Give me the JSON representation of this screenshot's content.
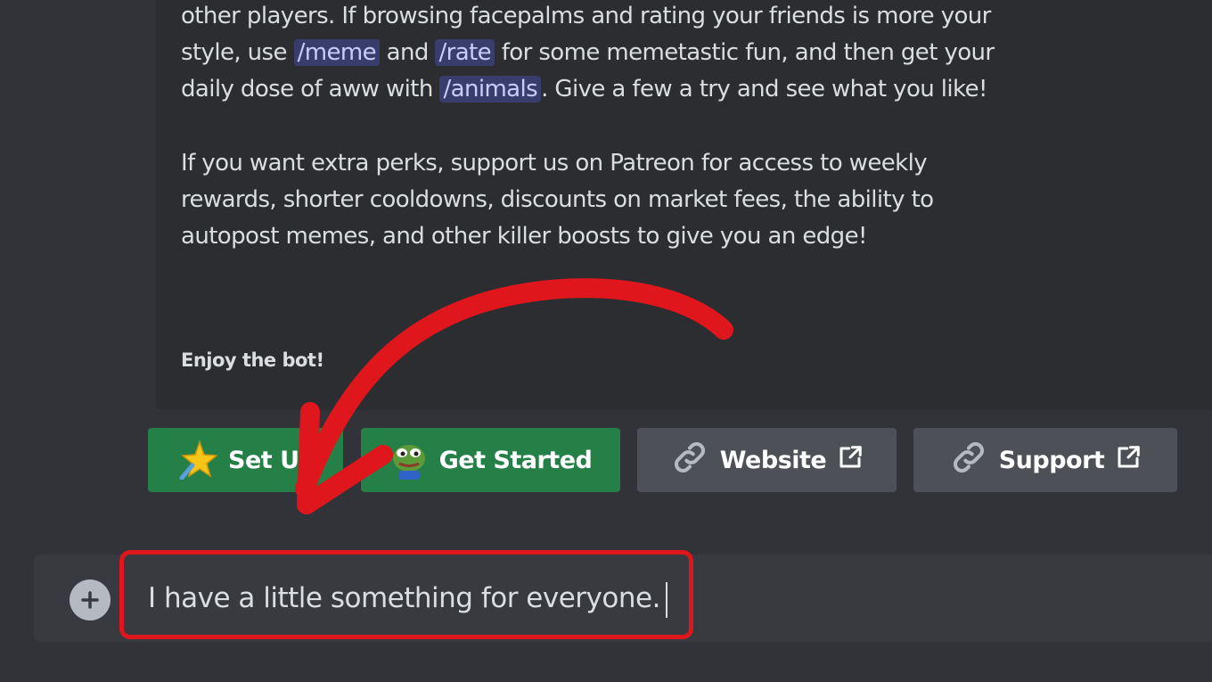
{
  "embed": {
    "para1": {
      "t1": "other players. If browsing facepalms and rating your friends is more your style, use",
      "cmd_meme": "/meme",
      "t2": "and",
      "cmd_rate": "/rate",
      "t3": "for some memetastic fun, and then get your daily dose of aww with",
      "cmd_animals": "/animals",
      "t4": ". Give a few a try and see what you like!"
    },
    "para2": "If you want extra perks, support us on Patreon for access to weekly rewards, shorter cooldowns, discounts on market fees, the ability to autopost memes, and other killer boosts to give you an edge!",
    "footer": "Enjoy the bot!"
  },
  "buttons": {
    "setup": {
      "label": "Set U",
      "icon": "star-emoji",
      "color": "#248046"
    },
    "get_started": {
      "label": "Get Started",
      "icon": "pepe-frog-emoji",
      "color": "#248046"
    },
    "website": {
      "label": "Website",
      "icon": "link-icon",
      "external_icon": "external-link-icon",
      "color": "#4e5058"
    },
    "support": {
      "label": "Support",
      "icon": "link-icon",
      "external_icon": "external-link-icon",
      "color": "#4e5058"
    }
  },
  "composer": {
    "value": "I have a little something for everyone.",
    "attach_icon": "plus-circle-icon"
  },
  "annotation": {
    "arrow_color": "#e0161d",
    "box_color": "#e0161d"
  }
}
